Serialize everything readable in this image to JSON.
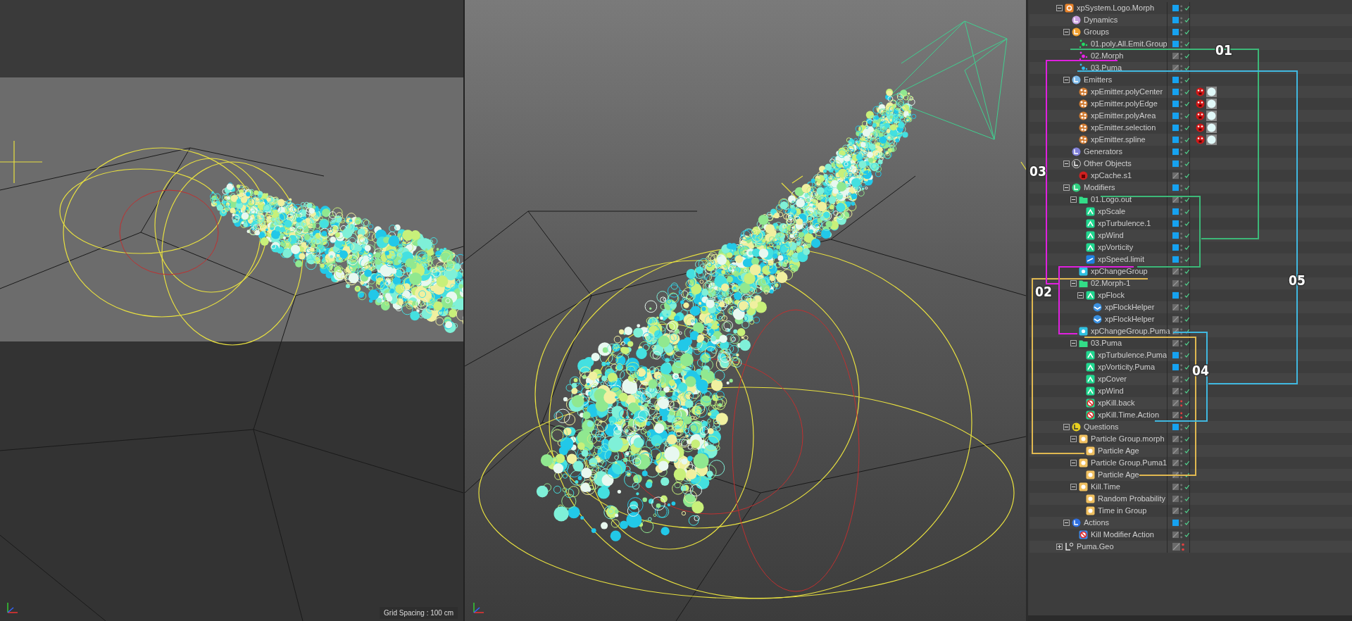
{
  "viewport_left": {
    "grid_spacing": "Grid Spacing : 100 cm"
  },
  "tree": [
    {
      "label": "xpSystem.Logo.Morph",
      "kind": "system",
      "enabled": true,
      "checked": true,
      "render_off": false,
      "expanded": true,
      "children": [
        {
          "label": "Dynamics",
          "kind": "dynamics",
          "enabled": true,
          "checked": true,
          "render_off": false
        },
        {
          "label": "Groups",
          "kind": "groups",
          "enabled": true,
          "checked": true,
          "render_off": false,
          "expanded": true,
          "children": [
            {
              "label": "01.poly.All.Emit.Group",
              "kind": "group",
              "color": "#22dd66",
              "enabled": true,
              "checked": true,
              "render_off": false
            },
            {
              "label": "02.Morph",
              "kind": "group",
              "color": "#ee22ee",
              "enabled": false,
              "checked": true,
              "render_off": false
            },
            {
              "label": "03.Puma",
              "kind": "group",
              "color": "#33bbee",
              "enabled": false,
              "checked": true,
              "render_off": false
            }
          ]
        },
        {
          "label": "Emitters",
          "kind": "emitters",
          "enabled": true,
          "checked": true,
          "render_off": false,
          "expanded": true,
          "children": [
            {
              "label": "xpEmitter.polyCenter",
              "kind": "emitter",
              "enabled": true,
              "checked": true,
              "render_off": false,
              "tags": true
            },
            {
              "label": "xpEmitter.polyEdge",
              "kind": "emitter",
              "enabled": true,
              "checked": true,
              "render_off": false,
              "tags": true
            },
            {
              "label": "xpEmitter.polyArea",
              "kind": "emitter",
              "enabled": true,
              "checked": true,
              "render_off": false,
              "tags": true
            },
            {
              "label": "xpEmitter.selection",
              "kind": "emitter",
              "enabled": true,
              "checked": true,
              "render_off": false,
              "tags": true
            },
            {
              "label": "xpEmitter.spline",
              "kind": "emitter",
              "enabled": true,
              "checked": true,
              "render_off": false,
              "tags": true
            }
          ]
        },
        {
          "label": "Generators",
          "kind": "generators",
          "enabled": true,
          "checked": true,
          "render_off": false
        },
        {
          "label": "Other Objects",
          "kind": "other",
          "enabled": true,
          "checked": true,
          "render_off": false,
          "expanded": true,
          "children": [
            {
              "label": "xpCache.s1",
              "kind": "cache",
              "enabled": false,
              "checked": true,
              "render_off": false
            }
          ]
        },
        {
          "label": "Modifiers",
          "kind": "modifiers",
          "enabled": true,
          "checked": true,
          "render_off": false,
          "expanded": true,
          "children": [
            {
              "label": "01.Logo.out",
              "kind": "folder",
              "enabled": false,
              "checked": true,
              "render_off": false,
              "expanded": true,
              "children": [
                {
                  "label": "xpScale",
                  "kind": "modifier",
                  "enabled": true,
                  "checked": true,
                  "render_off": false
                },
                {
                  "label": "xpTurbulence.1",
                  "kind": "modifier",
                  "enabled": true,
                  "checked": true,
                  "render_off": false
                },
                {
                  "label": "xpWind",
                  "kind": "modifier",
                  "enabled": true,
                  "checked": true,
                  "render_off": false
                },
                {
                  "label": "xpVorticity",
                  "kind": "modifier",
                  "enabled": true,
                  "checked": true,
                  "render_off": false
                },
                {
                  "label": "xpSpeed.limit",
                  "kind": "speed",
                  "enabled": true,
                  "checked": true,
                  "render_off": false
                }
              ]
            },
            {
              "label": "xpChangeGroup",
              "kind": "changegroup",
              "enabled": false,
              "checked": true,
              "render_off": false
            },
            {
              "label": "02.Morph-1",
              "kind": "folder",
              "enabled": false,
              "checked": true,
              "render_off": false,
              "expanded": true,
              "children": [
                {
                  "label": "xpFlock",
                  "kind": "modifier",
                  "enabled": true,
                  "checked": true,
                  "render_off": false,
                  "expanded": true,
                  "children": [
                    {
                      "label": "xpFlockHelper",
                      "kind": "flockhelper",
                      "enabled": false,
                      "checked": true,
                      "render_off": false
                    },
                    {
                      "label": "xpFlockHelper",
                      "kind": "flockhelper",
                      "enabled": false,
                      "checked": true,
                      "render_off": false
                    }
                  ]
                }
              ]
            },
            {
              "label": "xpChangeGroup.Puma",
              "kind": "changegroup",
              "enabled": false,
              "checked": true,
              "render_off": false
            },
            {
              "label": "03.Puma",
              "kind": "folder",
              "enabled": false,
              "checked": true,
              "render_off": false,
              "expanded": true,
              "children": [
                {
                  "label": "xpTurbulence.Puma",
                  "kind": "modifier",
                  "enabled": true,
                  "checked": true,
                  "render_off": false
                },
                {
                  "label": "xpVorticity.Puma",
                  "kind": "modifier",
                  "enabled": true,
                  "checked": true,
                  "render_off": false
                },
                {
                  "label": "xpCover",
                  "kind": "modifier",
                  "enabled": false,
                  "checked": true,
                  "render_off": false
                },
                {
                  "label": "xpWind",
                  "kind": "modifier",
                  "enabled": false,
                  "checked": true,
                  "render_off": false
                },
                {
                  "label": "xpKill.back",
                  "kind": "kill",
                  "enabled": false,
                  "checked": true,
                  "render_off": true
                },
                {
                  "label": "xpKill.Time.Action",
                  "kind": "kill",
                  "enabled": false,
                  "checked": true,
                  "render_off": true
                }
              ]
            }
          ]
        },
        {
          "label": "Questions",
          "kind": "questions",
          "enabled": true,
          "checked": true,
          "render_off": false,
          "expanded": true,
          "children": [
            {
              "label": "Particle Group.morph",
              "kind": "question",
              "enabled": false,
              "checked": true,
              "render_off": false,
              "expanded": true,
              "children": [
                {
                  "label": "Particle Age",
                  "kind": "question",
                  "enabled": false,
                  "checked": true,
                  "render_off": false
                }
              ]
            },
            {
              "label": "Particle Group.Puma1",
              "kind": "question",
              "enabled": false,
              "checked": true,
              "render_off": false,
              "expanded": true,
              "children": [
                {
                  "label": "Particle Age",
                  "kind": "question",
                  "enabled": false,
                  "checked": true,
                  "render_off": false
                }
              ]
            },
            {
              "label": "Kill.Time",
              "kind": "question",
              "enabled": false,
              "checked": true,
              "render_off": false,
              "expanded": true,
              "children": [
                {
                  "label": "Random Probability",
                  "kind": "question",
                  "enabled": false,
                  "checked": true,
                  "render_off": false
                },
                {
                  "label": "Time in Group",
                  "kind": "question",
                  "enabled": false,
                  "checked": true,
                  "render_off": false
                }
              ]
            }
          ]
        },
        {
          "label": "Actions",
          "kind": "actions",
          "enabled": true,
          "checked": true,
          "render_off": false,
          "expanded": true,
          "children": [
            {
              "label": "Kill Modifier Action",
              "kind": "action",
              "enabled": false,
              "checked": true,
              "render_off": false
            }
          ]
        }
      ]
    },
    {
      "label": "Puma.Geo",
      "kind": "null",
      "enabled": false,
      "checked": false,
      "render_off": true,
      "expanded": false
    }
  ],
  "annotations": [
    {
      "label": "01",
      "color": "#3cb878"
    },
    {
      "label": "02",
      "color": "#e0b850"
    },
    {
      "label": "03",
      "color": "#e020e0"
    },
    {
      "label": "04",
      "color": "#e0b850"
    },
    {
      "label": "05",
      "color": "#40b8e0"
    }
  ]
}
